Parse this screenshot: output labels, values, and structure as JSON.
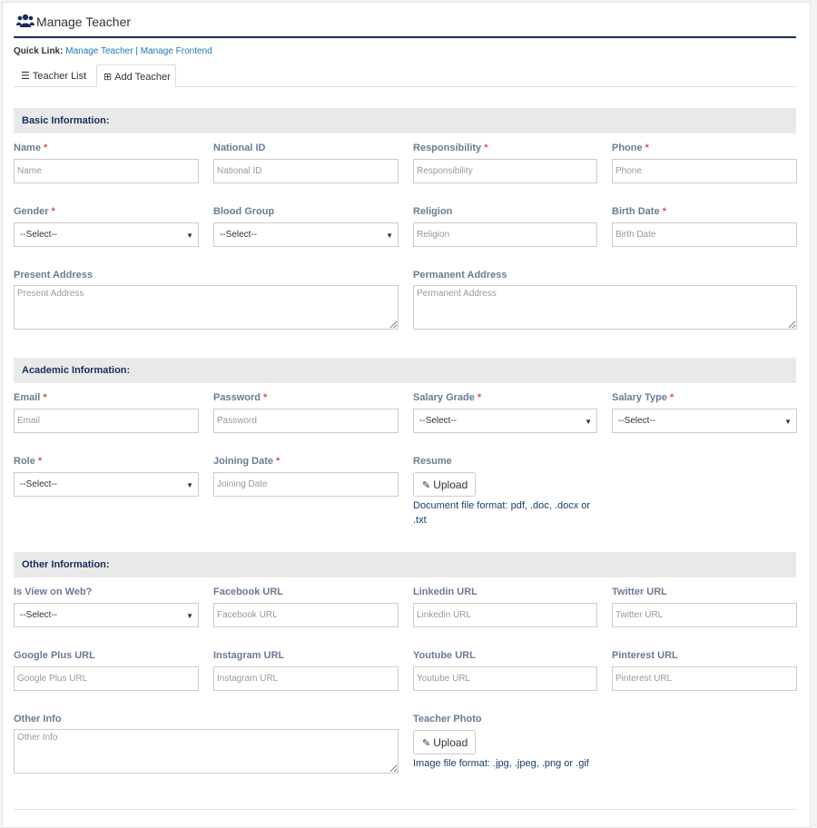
{
  "header": {
    "title": "Manage Teacher",
    "icon": "users-icon"
  },
  "quicklink": {
    "label": "Quick Link:",
    "links": [
      "Manage Teacher",
      "Manage Frontend"
    ],
    "separator": "|"
  },
  "tabs": [
    {
      "label": "Teacher List",
      "icon": "list-icon"
    },
    {
      "label": "Add Teacher",
      "icon": "plus-square-icon"
    }
  ],
  "sections": {
    "basic": "Basic Information:",
    "academic": "Academic Information:",
    "other": "Other Information:"
  },
  "basic": {
    "name": {
      "label": "Name",
      "req": "*",
      "placeholder": "Name"
    },
    "national_id": {
      "label": "National ID",
      "placeholder": "National ID"
    },
    "responsibility": {
      "label": "Responsibility",
      "req": "*",
      "placeholder": "Responsibility"
    },
    "phone": {
      "label": "Phone",
      "req": "*",
      "placeholder": "Phone"
    },
    "gender": {
      "label": "Gender",
      "req": "*",
      "value": "--Select--"
    },
    "blood_group": {
      "label": "Blood Group",
      "value": "--Select--"
    },
    "religion": {
      "label": "Religion",
      "placeholder": "Religion"
    },
    "birth_date": {
      "label": "Birth Date",
      "req": "*",
      "placeholder": "Birth Date"
    },
    "present_address": {
      "label": "Present Address",
      "placeholder": "Present Address"
    },
    "permanent_address": {
      "label": "Permanent Address",
      "placeholder": "Permanent Address"
    }
  },
  "academic": {
    "email": {
      "label": "Email",
      "req": "*",
      "placeholder": "Email"
    },
    "password": {
      "label": "Password",
      "req": "*",
      "placeholder": "Password"
    },
    "salary_grade": {
      "label": "Salary Grade",
      "req": "*",
      "value": "--Select--"
    },
    "salary_type": {
      "label": "Salary Type",
      "req": "*",
      "value": "--Select--"
    },
    "role": {
      "label": "Role",
      "req": "*",
      "value": "--Select--"
    },
    "joining_date": {
      "label": "Joining Date",
      "req": "*",
      "placeholder": "Joining Date"
    },
    "resume": {
      "label": "Resume",
      "button": "Upload",
      "hint_line1": "Document file format: pdf, .doc, .docx or",
      "hint_line2": ".txt"
    }
  },
  "other": {
    "view_on_web": {
      "label": "Is View on Web?",
      "value": "--Select--"
    },
    "facebook": {
      "label": "Facebook URL",
      "placeholder": "Facebook URL"
    },
    "linkedin": {
      "label": "Linkedin URL",
      "placeholder": "Linkedin URL"
    },
    "twitter": {
      "label": "Twitter URL",
      "placeholder": "Twitter URL"
    },
    "google_plus": {
      "label": "Google Plus URL",
      "placeholder": "Google Plus URL"
    },
    "instagram": {
      "label": "Instagram URL",
      "placeholder": "Instagram URL"
    },
    "youtube": {
      "label": "Youtube URL",
      "placeholder": "Youtube URL"
    },
    "pinterest": {
      "label": "Pinterest URL",
      "placeholder": "Pinterest URL"
    },
    "other_info": {
      "label": "Other Info",
      "placeholder": "Other Info"
    },
    "teacher_photo": {
      "label": "Teacher Photo",
      "button": "Upload",
      "hint": "Image file format: .jpg, .jpeg, .png or .gif"
    }
  },
  "colors": {
    "accent": "#1a2d5a",
    "link": "#1f77b4",
    "label": "#6b7b95",
    "required": "#d9534f",
    "section_bg": "#e9e9e9"
  }
}
